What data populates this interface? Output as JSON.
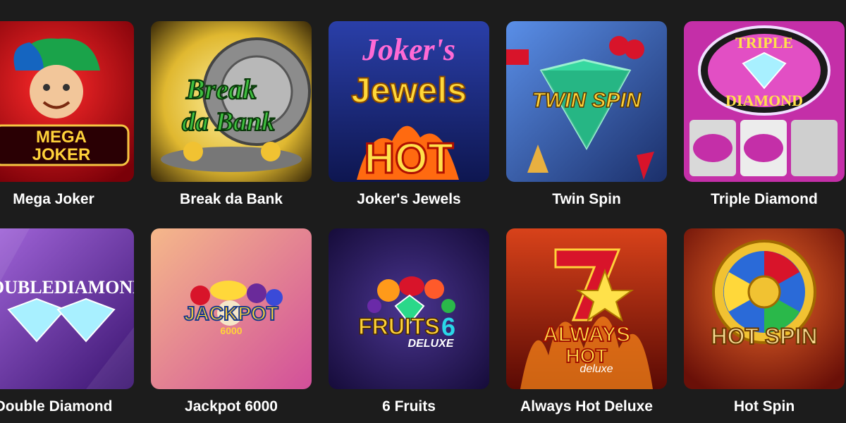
{
  "games": [
    {
      "title": "Mega Joker",
      "art_text": [
        "MEGA",
        "JOKER"
      ],
      "colors": [
        "#e0141c",
        "#7a0008"
      ]
    },
    {
      "title": "Break da Bank",
      "art_text": [
        "Break",
        "da Bank"
      ],
      "colors": [
        "#f5d04a",
        "#5a4a10"
      ]
    },
    {
      "title": "Joker's Jewels",
      "art_text": [
        "Joker's",
        "Jewels",
        "HOT"
      ],
      "colors": [
        "#2a3fa8",
        "#0e1650"
      ]
    },
    {
      "title": "Twin Spin",
      "art_text": [
        "TWIN SPIN"
      ],
      "colors": [
        "#4a7fd8",
        "#1b2f6a"
      ]
    },
    {
      "title": "Triple Diamond",
      "art_text": [
        "TRIPLE",
        "DIAMOND"
      ],
      "colors": [
        "#d23bb4",
        "#5a0f52"
      ]
    },
    {
      "title": "Double Diamond",
      "art_text": [
        "DOUBLEDIAMOND"
      ],
      "colors": [
        "#8c4ad6",
        "#3a1470"
      ]
    },
    {
      "title": "Jackpot 6000",
      "art_text": [
        "JACKPOT",
        "6000"
      ],
      "colors": [
        "#f0a880",
        "#d24f9a"
      ]
    },
    {
      "title": "6 Fruits",
      "art_text": [
        "FRUITS",
        "6",
        "DELUXE"
      ],
      "colors": [
        "#3d2a7a",
        "#160c3a"
      ]
    },
    {
      "title": "Always Hot Deluxe",
      "art_text": [
        "ALWAYS",
        "HOT",
        "deluxe"
      ],
      "colors": [
        "#d8421a",
        "#5a0a04"
      ]
    },
    {
      "title": "Hot Spin",
      "art_text": [
        "HOT SPIN"
      ],
      "colors": [
        "#e04a1a",
        "#6a1008"
      ]
    }
  ]
}
